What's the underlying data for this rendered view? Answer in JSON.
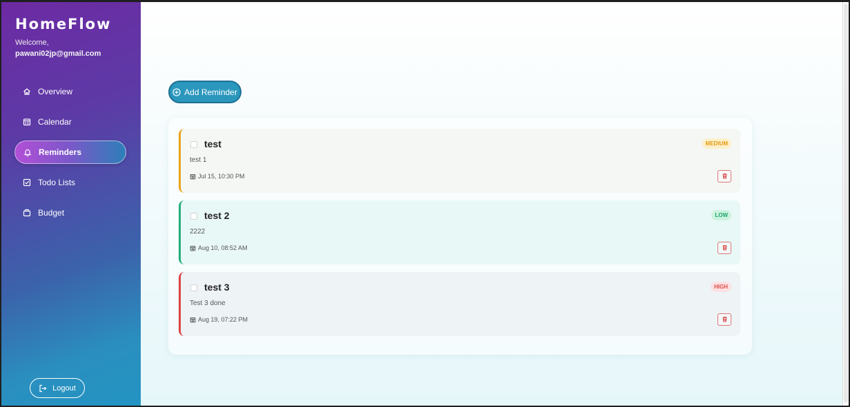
{
  "app": {
    "brand": "HomeFlow",
    "welcome": "Welcome,",
    "email": "pawani02jp@gmail.com"
  },
  "nav": [
    {
      "label": "Overview",
      "icon": "home-icon"
    },
    {
      "label": "Calendar",
      "icon": "calendar-icon"
    },
    {
      "label": "Reminders",
      "icon": "bell-icon",
      "active": true
    },
    {
      "label": "Todo Lists",
      "icon": "checkbox-icon"
    },
    {
      "label": "Budget",
      "icon": "wallet-icon"
    }
  ],
  "logout_label": "Logout",
  "add_reminder_label": "Add Reminder",
  "reminders": [
    {
      "title": "test",
      "description": "test 1",
      "date": "Jul 15, 10:30 PM",
      "priority": "MEDIUM"
    },
    {
      "title": "test 2",
      "description": "2222",
      "date": "Aug 10, 08:52 AM",
      "priority": "LOW"
    },
    {
      "title": "test 3",
      "description": "Test 3 done",
      "date": "Aug 19, 07:22 PM",
      "priority": "HIGH"
    }
  ],
  "colors": {
    "priority_medium": "#e9a31b",
    "priority_low": "#22ad7a",
    "priority_high": "#dc4444",
    "accent": "#2b97bd"
  }
}
